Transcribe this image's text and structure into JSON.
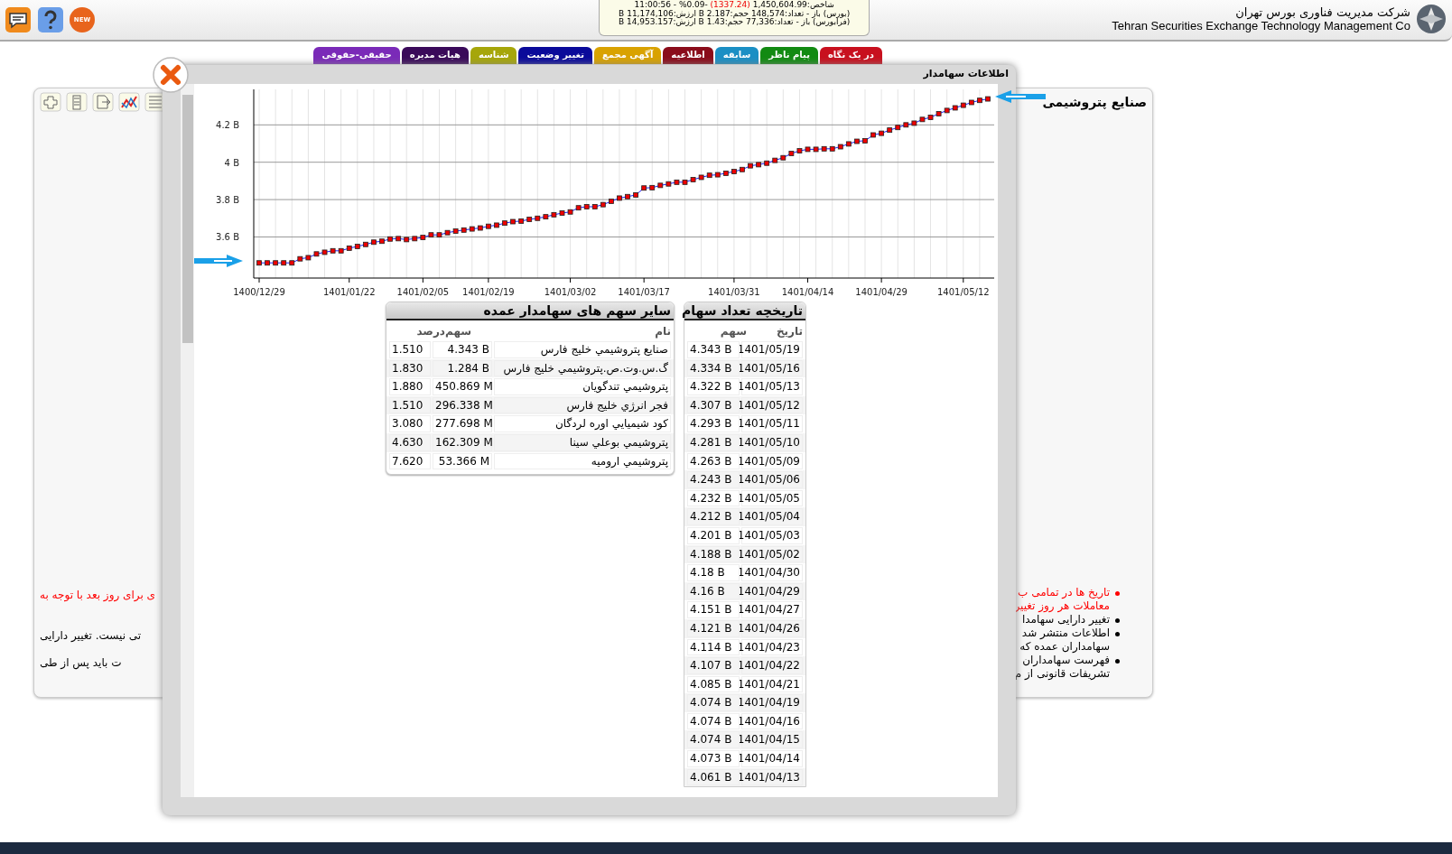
{
  "header": {
    "new_badge": "NEW",
    "ticker": {
      "index": {
        "label": "شاخص:1,450,604.99",
        "change": "(1337.24)",
        "tail": "-0.09% - 11:00:56"
      },
      "lines": [
        "(بورس) باز - تعداد:148,574 حجم:2.187 B ارزش:11,174,106 B",
        "(فرابورس) باز - تعداد:77,336 حجم:1.43 B ارزش:14,953.157 B"
      ]
    },
    "company_fa": "شرکت مدیریت فناوری بورس تهران",
    "company_en": "Tehran Securities Exchange Technology Management Co"
  },
  "tabs": [
    {
      "label": "در یک نگاه",
      "color": "#c8101e"
    },
    {
      "label": "پیام ناظر",
      "color": "#128a12"
    },
    {
      "label": "سابقه",
      "color": "#1b8fc4"
    },
    {
      "label": "اطلاعیه",
      "color": "#8a0c1a"
    },
    {
      "label": "آگهی مجمع",
      "color": "#d9a200"
    },
    {
      "label": "تغییر وضعیت",
      "color": "#0a0a9a"
    },
    {
      "label": "شناسه",
      "color": "#a6a60a"
    },
    {
      "label": "هیات مدیره",
      "color": "#3a0a5a"
    },
    {
      "label": "حقیقی-حقوقی",
      "color": "#7a2ab8"
    }
  ],
  "background": {
    "title": "صنایع پتروشیمی",
    "left_notes": [
      {
        "text": "ی برای روز بعد با توجه به",
        "color": "#ff0000"
      },
      {
        "text": "تی نیست. تغییر دارایی",
        "color": "#000000"
      },
      {
        "text": "ت باید پس از طی",
        "color": "#000000"
      }
    ],
    "right_notes": [
      {
        "lines": [
          "تاریخ ها در تمامی ب",
          "معاملات هر روز تغییر"
        ],
        "color": "#ff0000"
      },
      {
        "lines": [
          "تغییر دارایی سهامدا"
        ],
        "color": "#000000"
      },
      {
        "lines": [
          "اطلاعات منتشر شد",
          "سهامداران عمده که"
        ],
        "color": "#000000"
      },
      {
        "lines": [
          "فهرست سهامداران",
          "تشریفات قانونی از م"
        ],
        "color": "#000000"
      }
    ]
  },
  "modal": {
    "title": "اطلاعات سهامدار",
    "chart_data": {
      "type": "line",
      "ylim": [
        3.38,
        4.39
      ],
      "grid": true,
      "categories": [
        "1400/12/29",
        null,
        null,
        null,
        null,
        null,
        null,
        null,
        null,
        null,
        null,
        "1401/01/22",
        null,
        null,
        null,
        null,
        null,
        null,
        null,
        null,
        "1401/02/05",
        null,
        null,
        null,
        null,
        null,
        null,
        null,
        "1401/02/19",
        null,
        null,
        null,
        null,
        null,
        null,
        null,
        null,
        null,
        "1401/03/02",
        null,
        null,
        null,
        null,
        null,
        null,
        null,
        null,
        "1401/03/17",
        null,
        null,
        null,
        null,
        null,
        null,
        null,
        null,
        null,
        null,
        "1401/03/31",
        null,
        null,
        null,
        null,
        null,
        null,
        null,
        null,
        "1401/04/14",
        null,
        null,
        null,
        null,
        null,
        null,
        null,
        null,
        "1401/04/29",
        null,
        null,
        null,
        null,
        null,
        null,
        null,
        null,
        null,
        "1401/05/12",
        null,
        null,
        null
      ],
      "yticks": [
        {
          "value": 3.6,
          "label": "3.6 B"
        },
        {
          "value": 3.8,
          "label": "3.8 B"
        },
        {
          "value": 4.0,
          "label": "4 B"
        },
        {
          "value": 4.2,
          "label": "4.2 B"
        }
      ],
      "series": [
        {
          "color": "#2222ff",
          "marker": "square",
          "values": [
            3.461,
            3.461,
            3.461,
            3.461,
            3.461,
            3.483,
            3.489,
            3.509,
            3.518,
            3.526,
            3.526,
            3.54,
            3.549,
            3.56,
            3.572,
            3.577,
            3.589,
            3.591,
            3.586,
            3.591,
            3.597,
            3.611,
            3.611,
            3.623,
            3.631,
            3.637,
            3.643,
            3.648,
            3.657,
            3.663,
            3.674,
            3.682,
            3.685,
            3.694,
            3.7,
            3.708,
            3.719,
            3.728,
            3.734,
            3.756,
            3.762,
            3.762,
            3.773,
            3.791,
            3.808,
            3.816,
            3.825,
            3.862,
            3.864,
            3.876,
            3.884,
            3.893,
            3.893,
            3.907,
            3.919,
            3.93,
            3.933,
            3.941,
            3.95,
            3.961,
            3.981,
            3.987,
            3.995,
            4.01,
            4.024,
            4.047,
            4.061,
            4.069,
            4.069,
            4.072,
            4.072,
            4.083,
            4.098,
            4.112,
            4.115,
            4.146,
            4.155,
            4.172,
            4.186,
            4.2,
            4.209,
            4.229,
            4.24,
            4.26,
            4.277,
            4.291,
            4.305,
            4.32,
            4.331,
            4.339
          ]
        }
      ]
    },
    "history": {
      "title": "تاریخچه تعداد سهام",
      "columns": [
        "تاریخ",
        "سهم"
      ],
      "rows": [
        [
          "1401/05/19",
          "4.343 B"
        ],
        [
          "1401/05/16",
          "4.334 B"
        ],
        [
          "1401/05/13",
          "4.322 B"
        ],
        [
          "1401/05/12",
          "4.307 B"
        ],
        [
          "1401/05/11",
          "4.293 B"
        ],
        [
          "1401/05/10",
          "4.281 B"
        ],
        [
          "1401/05/09",
          "4.263 B"
        ],
        [
          "1401/05/06",
          "4.243 B"
        ],
        [
          "1401/05/05",
          "4.232 B"
        ],
        [
          "1401/05/04",
          "4.212 B"
        ],
        [
          "1401/05/03",
          "4.201 B"
        ],
        [
          "1401/05/02",
          "4.188 B"
        ],
        [
          "1401/04/30",
          "4.18 B"
        ],
        [
          "1401/04/29",
          "4.16 B"
        ],
        [
          "1401/04/27",
          "4.151 B"
        ],
        [
          "1401/04/26",
          "4.121 B"
        ],
        [
          "1401/04/23",
          "4.114 B"
        ],
        [
          "1401/04/22",
          "4.107 B"
        ],
        [
          "1401/04/21",
          "4.085 B"
        ],
        [
          "1401/04/19",
          "4.074 B"
        ],
        [
          "1401/04/16",
          "4.074 B"
        ],
        [
          "1401/04/15",
          "4.074 B"
        ],
        [
          "1401/04/14",
          "4.073 B"
        ],
        [
          "1401/04/13",
          "4.061 B"
        ]
      ]
    },
    "holdings": {
      "title": "سایر سهم های سهامدار عمده",
      "columns": [
        "نام",
        "سهم",
        "درصد"
      ],
      "rows": [
        [
          "صنایع پتروشیمي خليج فارس",
          "4.343 B",
          "1.510"
        ],
        [
          "گ.س.وت.ص.پتروشیمي خلیج فارس",
          "1.284 B",
          "1.830"
        ],
        [
          "پتروشیمي تندگویان",
          "450.869 M",
          "1.880"
        ],
        [
          "فجر انرژي خليج فارس",
          "296.338 M",
          "1.510"
        ],
        [
          "كود شيميايي اوره لردگان",
          "277.698 M",
          "3.080"
        ],
        [
          "پتروشیمي بوعلي سينا",
          "162.309 M",
          "4.630"
        ],
        [
          "پتروشیمي اروميه",
          "53.366 M",
          "7.620"
        ]
      ]
    }
  }
}
